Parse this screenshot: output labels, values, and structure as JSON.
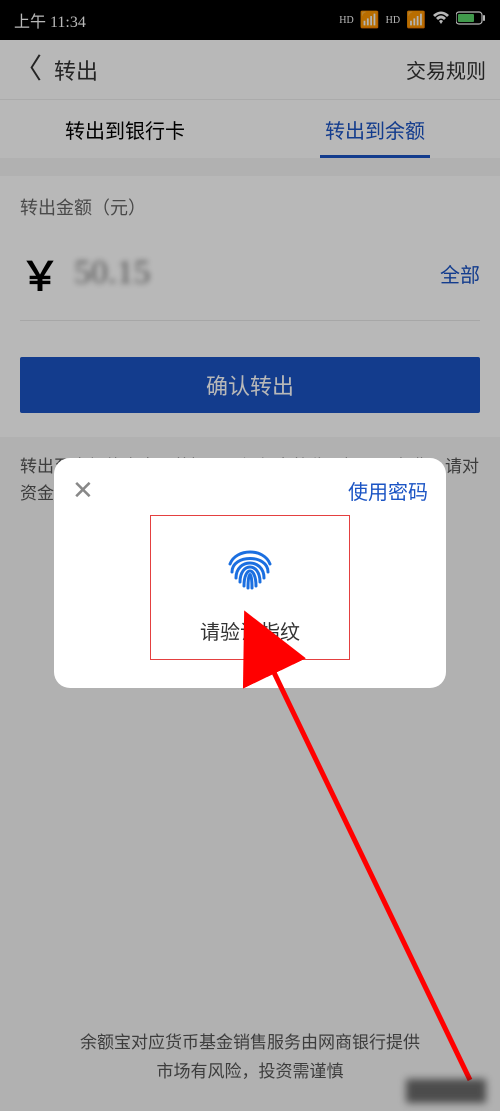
{
  "status": {
    "time": "上午 11:34"
  },
  "header": {
    "title": "转出",
    "right": "交易规则"
  },
  "tabs": {
    "bank": "转出到银行卡",
    "balance": "转出到余额"
  },
  "amount": {
    "label": "转出金额（元）",
    "currency": "￥",
    "value": "50.15",
    "all": "全部"
  },
  "confirm": "确认转出",
  "warn": "转出至余额的资金，若提现至银行卡将收取提现服务费，请对资金进…",
  "modal": {
    "use_password": "使用密码",
    "prompt": "请验证指纹"
  },
  "footer": {
    "line1": "余额宝对应货币基金销售服务由网商银行提供",
    "line2": "市场有风险，投资需谨慎"
  }
}
